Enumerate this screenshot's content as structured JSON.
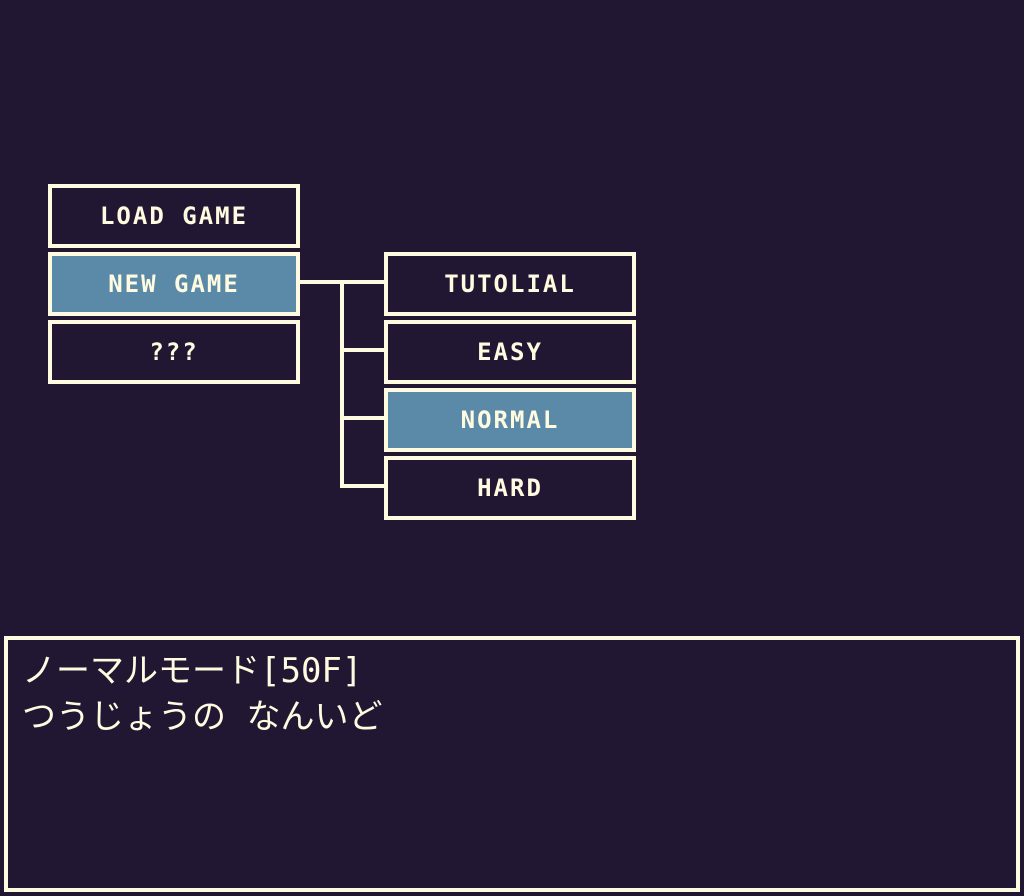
{
  "main_menu": {
    "items": [
      {
        "label": "LOAD GAME",
        "selected": false
      },
      {
        "label": "NEW GAME",
        "selected": true
      },
      {
        "label": "???",
        "selected": false
      }
    ]
  },
  "difficulty_menu": {
    "items": [
      {
        "label": "TUTOLIAL",
        "selected": false
      },
      {
        "label": "EASY",
        "selected": false
      },
      {
        "label": "NORMAL",
        "selected": true
      },
      {
        "label": "HARD",
        "selected": false
      }
    ]
  },
  "message": {
    "line1": "ノーマルモード[50F]",
    "line2": "つうじょうの なんいど"
  },
  "colors": {
    "background": "#221733",
    "border": "#fffbe0",
    "selected": "#5b8aa8"
  }
}
